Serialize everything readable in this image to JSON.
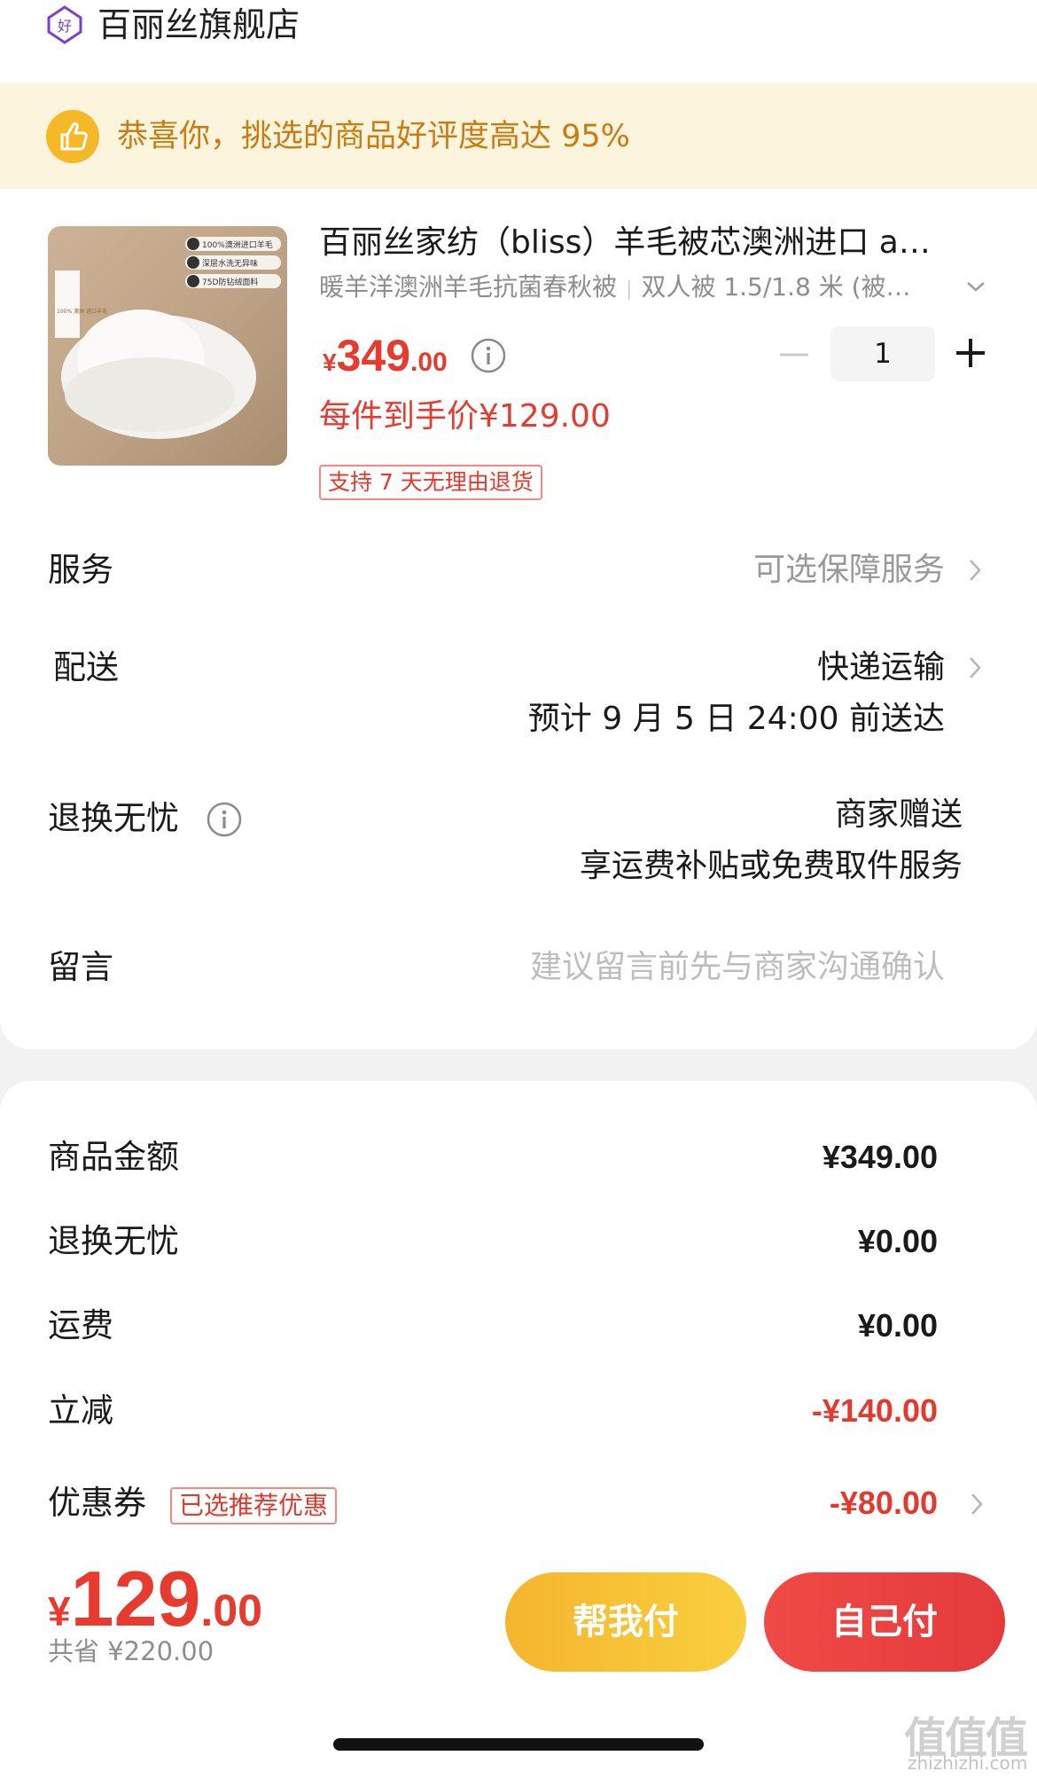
{
  "store": {
    "name": "百丽丝旗舰店",
    "logo_icon": "diamond-hao-icon"
  },
  "banner": {
    "text": "恭喜你，挑选的商品好评度高达 95%",
    "icon": "thumbs-up-icon"
  },
  "product": {
    "title": "百丽丝家纺（bliss）羊毛被芯澳洲进口 a…",
    "spec_name": "暖羊洋澳洲羊毛抗菌春秋被",
    "spec_size": "双人被 1.5/1.8 米 (被…",
    "image_labels": [
      "100%澳洲进口羊毛",
      "深层水洗无异味",
      "75D防钻绒面料",
      "100% 澳洲 进口羊毛"
    ],
    "price_symbol": "¥",
    "price_int": "349",
    "price_dec": ".00",
    "per_item_price": "每件到手价¥129.00",
    "return_tag": "支持 7 天无理由退货",
    "quantity": "1"
  },
  "rows": {
    "service": {
      "label": "服务",
      "value": "可选保障服务"
    },
    "delivery": {
      "label": "配送",
      "value1": "快递运输",
      "value2": "预计 9 月 5 日 24:00 前送达"
    },
    "return": {
      "label": "退换无忧",
      "value1": "商家赠送",
      "value2": "享运费补贴或免费取件服务"
    },
    "message": {
      "label": "留言",
      "placeholder": "建议留言前先与商家沟通确认"
    }
  },
  "summary": {
    "goods_amount": {
      "label": "商品金额",
      "value": "¥349.00"
    },
    "return_fee": {
      "label": "退换无忧",
      "value": "¥0.00"
    },
    "shipping": {
      "label": "运费",
      "value": "¥0.00"
    },
    "discount": {
      "label": "立减",
      "value": "-¥140.00"
    },
    "coupon": {
      "label": "优惠券",
      "tag": "已选推荐优惠",
      "value": "-¥80.00"
    }
  },
  "footer": {
    "total_symbol": "¥",
    "total_int": "129",
    "total_dec": ".00",
    "saved": "共省 ¥220.00",
    "help_pay": "帮我付",
    "self_pay": "自己付"
  },
  "watermark": {
    "main": "值值值",
    "sub": "zhizhizhi.com"
  },
  "colors": {
    "accent_red": "#e63b2e",
    "banner_bg": "#fdf4de",
    "banner_text": "#c97c12",
    "help_btn": "#f6b52f",
    "self_btn": "#e43b3c"
  }
}
